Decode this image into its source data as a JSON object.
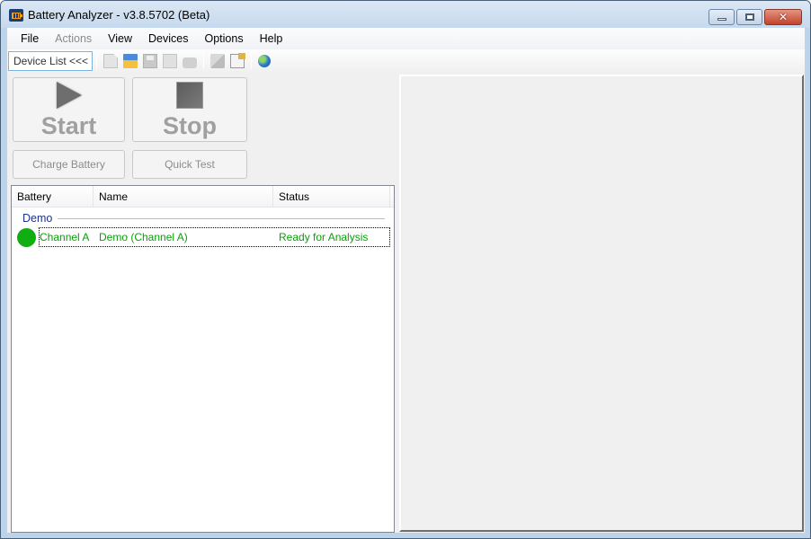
{
  "window": {
    "title": "Battery Analyzer - v3.8.5702 (Beta)",
    "controls": {
      "minimize": "minimize",
      "maximize": "maximize",
      "close": "✕"
    }
  },
  "menu": [
    {
      "label": "File",
      "enabled": true
    },
    {
      "label": "Actions",
      "enabled": false
    },
    {
      "label": "View",
      "enabled": true
    },
    {
      "label": "Devices",
      "enabled": true
    },
    {
      "label": "Options",
      "enabled": true
    },
    {
      "label": "Help",
      "enabled": true
    }
  ],
  "toolbar": {
    "device_list_label": "Device List <<<",
    "icons": [
      "new-file-icon",
      "open-folder-icon",
      "save-icon",
      "pdf-export-icon",
      "print-icon",
      "edit-icon",
      "properties-icon",
      "globe-icon"
    ]
  },
  "actions": {
    "start_label": "Start",
    "stop_label": "Stop",
    "charge_label": "Charge Battery",
    "quick_test_label": "Quick Test"
  },
  "device_list": {
    "columns": [
      "Battery",
      "Name",
      "Status"
    ],
    "groups": [
      {
        "name": "Demo",
        "rows": [
          {
            "battery": "Channel A",
            "name": "Demo (Channel A)",
            "status": "Ready for Analysis",
            "indicator_color": "#10ae10"
          }
        ]
      }
    ]
  }
}
